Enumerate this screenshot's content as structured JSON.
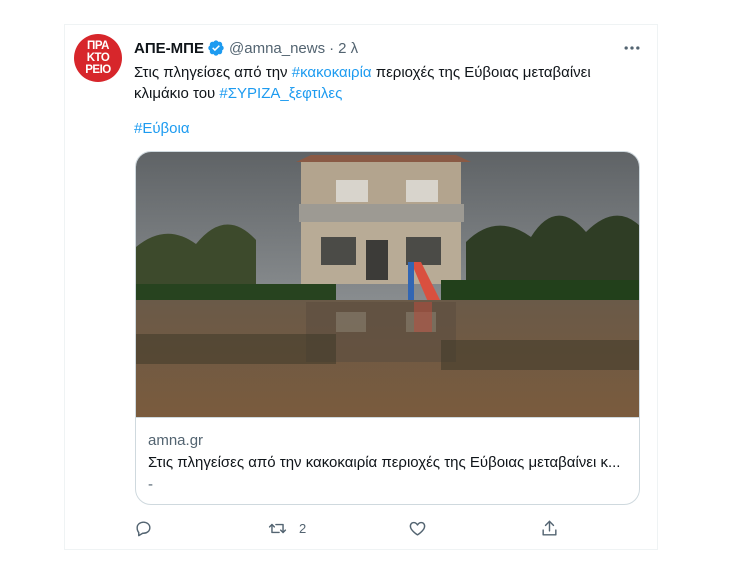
{
  "tweet": {
    "avatar_lines": [
      "ΠΡΑ",
      "ΚΤΟ",
      "ΡΕΙΟ"
    ],
    "author_name": "ΑΠΕ-ΜΠΕ",
    "verified_icon": "verified-badge-icon",
    "handle": "@amna_news",
    "separator": "·",
    "time": "2 λ",
    "more_icon": "more-options-icon",
    "text_part1": "Στις πληγείσες από την ",
    "hashtag1": "#κακοκαιρία",
    "text_part2": " περιοχές της Εύβοιας μεταβαίνει κλιμάκιο του ",
    "hashtag2": "#ΣΥΡΙΖΑ_ξεφτιλες",
    "hashtag3": "#Εύβοια"
  },
  "card": {
    "image_icon": "flooded-house-photo",
    "domain": "amna.gr",
    "title": "Στις πληγείσες από την κακοκαιρία περιοχές της Εύβοιας μεταβαίνει κ...",
    "description": "-"
  },
  "actions": {
    "reply_icon": "reply-icon",
    "retweet_icon": "retweet-icon",
    "retweet_count": "2",
    "like_icon": "heart-icon",
    "share_icon": "share-icon"
  },
  "colors": {
    "link": "#1d9bf0",
    "secondary_text": "#536471",
    "avatar_bg": "#d7262b",
    "border": "#cfd9de"
  }
}
